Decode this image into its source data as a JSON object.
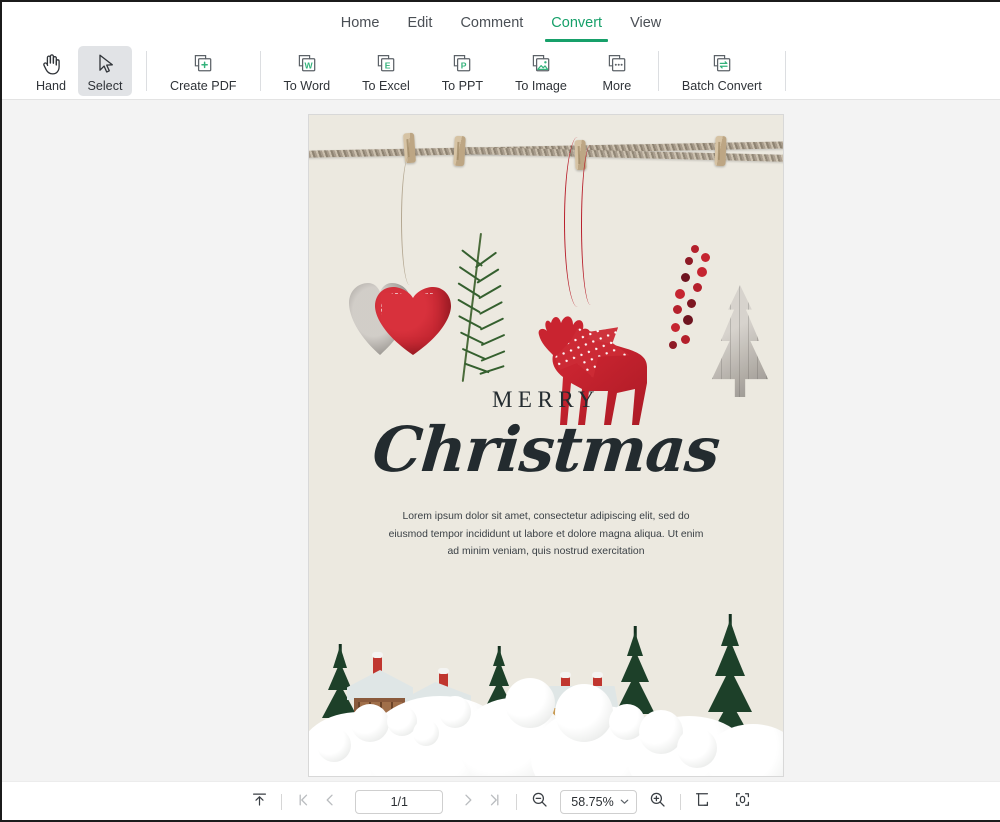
{
  "window": {
    "tabs": [
      {
        "label": "Home",
        "active": false
      },
      {
        "label": "Edit",
        "active": false
      },
      {
        "label": "Comment",
        "active": false
      },
      {
        "label": "Convert",
        "active": true
      },
      {
        "label": "View",
        "active": false
      }
    ]
  },
  "toolbar": {
    "items": [
      {
        "label": "Hand",
        "icon": "hand-icon",
        "selected": false
      },
      {
        "label": "Select",
        "icon": "cursor-arrow-icon",
        "selected": true
      },
      {
        "label": "Create PDF",
        "icon": "create-pdf-icon",
        "selected": false
      },
      {
        "label": "To Word",
        "icon": "to-word-icon",
        "selected": false
      },
      {
        "label": "To Excel",
        "icon": "to-excel-icon",
        "selected": false
      },
      {
        "label": "To PPT",
        "icon": "to-ppt-icon",
        "selected": false
      },
      {
        "label": "To Image",
        "icon": "to-image-icon",
        "selected": false
      },
      {
        "label": "More",
        "icon": "more-dots-icon",
        "selected": false
      },
      {
        "label": "Batch Convert",
        "icon": "batch-convert-icon",
        "selected": false
      }
    ]
  },
  "document": {
    "heading_small": "MERRY",
    "heading_script": "Christmas",
    "body_lines": [
      "Lorem ipsum dolor sit amet, consectetur adipiscing elit, sed do",
      "eiusmod tempor incididunt ut labore et dolore magna aliqua. Ut enim",
      "ad minim veniam, quis nostrud exercitation"
    ],
    "background_color": "#ece9e0"
  },
  "status": {
    "scroll_top_icon": "scroll-to-top-icon",
    "first_page_icon": "first-page-icon",
    "prev_page_icon": "previous-page-icon",
    "page_indicator": "1/1",
    "next_page_icon": "next-page-icon",
    "last_page_icon": "last-page-icon",
    "zoom_out_icon": "zoom-out-icon",
    "zoom_level": "58.75%",
    "zoom_dropdown_icon": "chevron-down-icon",
    "zoom_in_icon": "zoom-in-icon",
    "fit_page_icon": "fit-page-icon",
    "fit_visible_icon": "fit-visible-icon"
  },
  "colors": {
    "accent_green": "#17a06a",
    "canvas_bg": "#f3f3f3",
    "selected_tool_bg": "#e1e3e6"
  }
}
